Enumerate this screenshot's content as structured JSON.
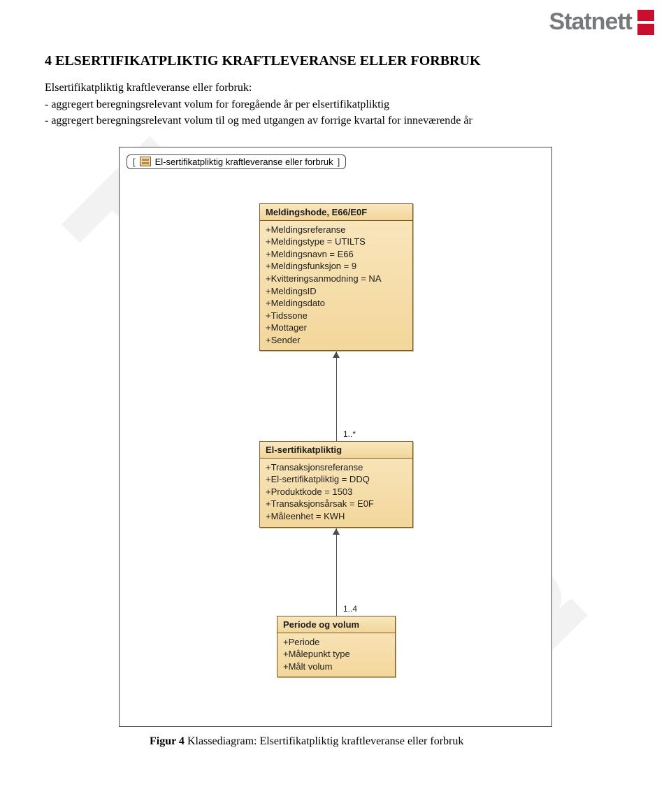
{
  "logo": {
    "text": "Statnett"
  },
  "watermark": "Forslag",
  "section": {
    "number": "4",
    "title_first_word": "E",
    "title_rest": "LSERTIFIKATPLIKTIG KRAFTLEVERANSE ELLER FORBRUK"
  },
  "body": {
    "line1": "Elsertifikatpliktig kraftleveranse eller forbruk:",
    "line2": "- aggregert beregningsrelevant volum for foregående år per elsertifikatpliktig",
    "line3": "- aggregert beregningsrelevant volum til og med utgangen av forrige kvartal for inneværende år"
  },
  "diagram": {
    "tab_label": "El-sertifikatpliktig kraftleveranse eller forbruk",
    "box1": {
      "title": "Meldingshode, E66/E0F",
      "attrs": [
        "+Meldingsreferanse",
        "+Meldingstype = UTILTS",
        "+Meldingsnavn = E66",
        "+Meldingsfunksjon = 9",
        "+Kvitteringsanmodning = NA",
        "+MeldingsID",
        "+Meldingsdato",
        "+Tidssone",
        "+Mottager",
        "+Sender"
      ]
    },
    "mult1": "1..*",
    "box2": {
      "title": "El-sertifikatpliktig",
      "attrs": [
        "+Transaksjonsreferanse",
        "+El-sertifikatpliktig = DDQ",
        "+Produktkode = 1503",
        "+Transaksjonsårsak = E0F",
        "+Måleenhet = KWH"
      ]
    },
    "mult2": "1..4",
    "box3": {
      "title": "Periode og volum",
      "attrs": [
        "+Periode",
        "+Målepunkt type",
        "+Målt volum"
      ]
    }
  },
  "caption": {
    "label": "Figur 4",
    "text": " Klassediagram: Elsertifikatpliktig kraftleveranse eller forbruk"
  }
}
